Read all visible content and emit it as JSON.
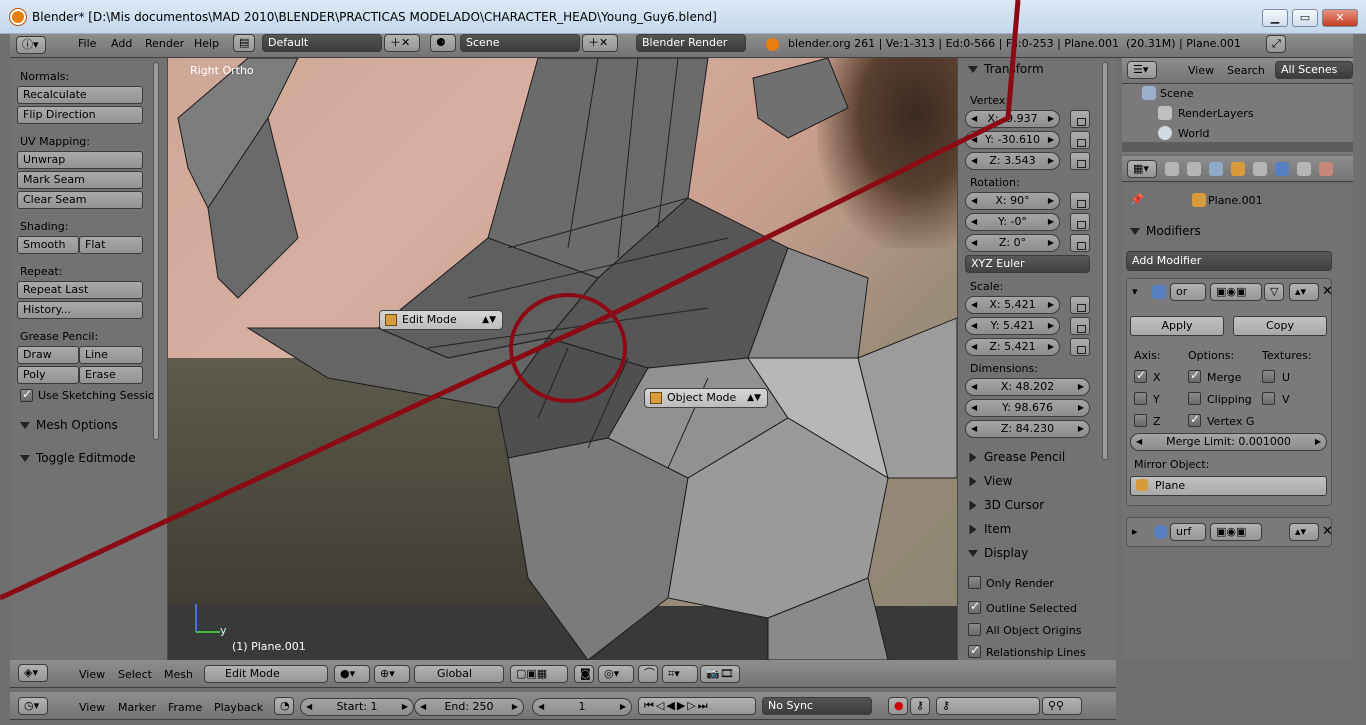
{
  "window": {
    "title": "Blender* [D:\\Mis documentos\\MAD 2010\\BLENDER\\PRACTICAS MODELADO\\CHARACTER_HEAD\\Young_Guy6.blend]",
    "minimize": "▁",
    "maximize": "▭",
    "close": "✕"
  },
  "info_header": {
    "menus": [
      "File",
      "Add",
      "Render",
      "Help"
    ],
    "layout": "Default",
    "scene": "Scene",
    "engine": "Blender Render",
    "stats": "blender.org 261 | Ve:1-313 | Ed:0-566 | Fa:0-253 | Plane.001",
    "mem": "(20.31M) | Plane.001"
  },
  "toolshelf": {
    "normals_label": "Normals:",
    "recalculate": "Recalculate",
    "flip_direction": "Flip Direction",
    "uv_label": "UV Mapping:",
    "unwrap": "Unwrap",
    "mark_seam": "Mark Seam",
    "clear_seam": "Clear Seam",
    "shading_label": "Shading:",
    "smooth": "Smooth",
    "flat": "Flat",
    "repeat_label": "Repeat:",
    "repeat_last": "Repeat Last",
    "history": "History...",
    "grease_label": "Grease Pencil:",
    "draw": "Draw",
    "line": "Line",
    "poly": "Poly",
    "erase": "Erase",
    "use_sketching": "Use Sketching Sessio",
    "mesh_options": "Mesh Options",
    "toggle_editmode": "Toggle Editmode"
  },
  "viewport": {
    "view_name": "Right Ortho",
    "object_info": "(1) Plane.001",
    "axis_y": "y",
    "edit_mode_popup": "Edit Mode",
    "object_mode_popup": "Object Mode"
  },
  "npanel": {
    "transform": "Transform",
    "vertex_label": "Vertex:",
    "vx": "X: -9.937",
    "vy": "Y: -30.610",
    "vz": "Z: 3.543",
    "rotation_label": "Rotation:",
    "rx": "X: 90°",
    "ry": "Y: -0°",
    "rz": "Z: 0°",
    "rot_mode": "XYZ Euler",
    "scale_label": "Scale:",
    "sx": "X: 5.421",
    "sy": "Y: 5.421",
    "sz": "Z: 5.421",
    "dim_label": "Dimensions:",
    "dx": "X: 48.202",
    "dy": "Y: 98.676",
    "dz": "Z: 84.230",
    "grease_pencil": "Grease Pencil",
    "view": "View",
    "cursor": "3D Cursor",
    "item": "Item",
    "display": "Display",
    "only_render": "Only Render",
    "outline_selected": "Outline Selected",
    "all_object_origins": "All Object Origins",
    "relationship_lines": "Relationship Lines"
  },
  "outliner": {
    "view": "View",
    "search": "Search",
    "filter": "All Scenes",
    "scene": "Scene",
    "renderlayers": "RenderLayers",
    "world": "World"
  },
  "properties": {
    "object": "Plane.001",
    "modifiers": "Modifiers",
    "add_modifier": "Add Modifier",
    "mod1_name": "or",
    "apply": "Apply",
    "copy": "Copy",
    "axis_label": "Axis:",
    "options_label": "Options:",
    "textures_label": "Textures:",
    "x": "X",
    "y": "Y",
    "z": "Z",
    "merge": "Merge",
    "clipping": "Clipping",
    "vertex_g": "Vertex G",
    "u": "U",
    "v": "V",
    "merge_limit": "Merge Limit: 0.001000",
    "mirror_object_label": "Mirror Object:",
    "mirror_object": "Plane",
    "mod2_name": "urf"
  },
  "view3d_header": {
    "view": "View",
    "select": "Select",
    "mesh": "Mesh",
    "mode": "Edit Mode",
    "orientation": "Global"
  },
  "timeline": {
    "view": "View",
    "marker": "Marker",
    "frame": "Frame",
    "playback": "Playback",
    "start": "Start: 1",
    "end": "End: 250",
    "current": "1",
    "sync": "No Sync"
  },
  "colors": {
    "annotation_red": "#8b0a14",
    "accent_blue": "#5680c2"
  }
}
